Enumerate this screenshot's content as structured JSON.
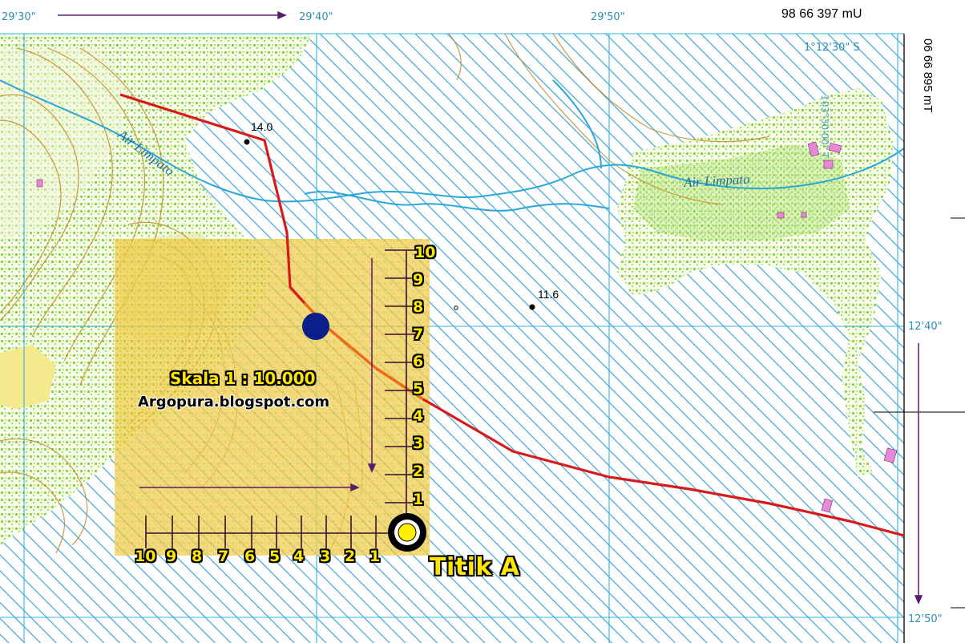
{
  "header": {
    "lon_labels": [
      "29'30\"",
      "29'40\"",
      "29'50\""
    ],
    "northing_label": "98 66 397 mU",
    "lat_label_top": "1°12'30\" S",
    "lon_vertical": "103°30'00\" T"
  },
  "side": {
    "easting_label": "06 66 895 mT",
    "lat_labels": [
      "12'40\"",
      "12'50\""
    ]
  },
  "map": {
    "rivers": [
      "Air Limpato",
      "Air Limpato"
    ],
    "elevations": [
      "14.0",
      "11.6"
    ],
    "point_label": "Titik A",
    "colors": {
      "water_hatch": "#3aa6d6",
      "grid": "#33b6e0",
      "contour": "#c08a2a",
      "vegetation": "#8fd44a",
      "route": "#d81a1a",
      "overlay": "#f0c028",
      "arrow": "#5a1a6e",
      "point_a_fill": "#ffef00",
      "blue_point": "#0a1f8a"
    }
  },
  "scale_card": {
    "title": "Skala 1 : 10.000",
    "credit": "Argopura.blogspot.com",
    "vertical_ticks": [
      "1",
      "2",
      "3",
      "4",
      "5",
      "6",
      "7",
      "8",
      "9",
      "10"
    ],
    "horizontal_ticks": [
      "1",
      "2",
      "3",
      "4",
      "5",
      "6",
      "7",
      "8",
      "9",
      "10"
    ]
  }
}
